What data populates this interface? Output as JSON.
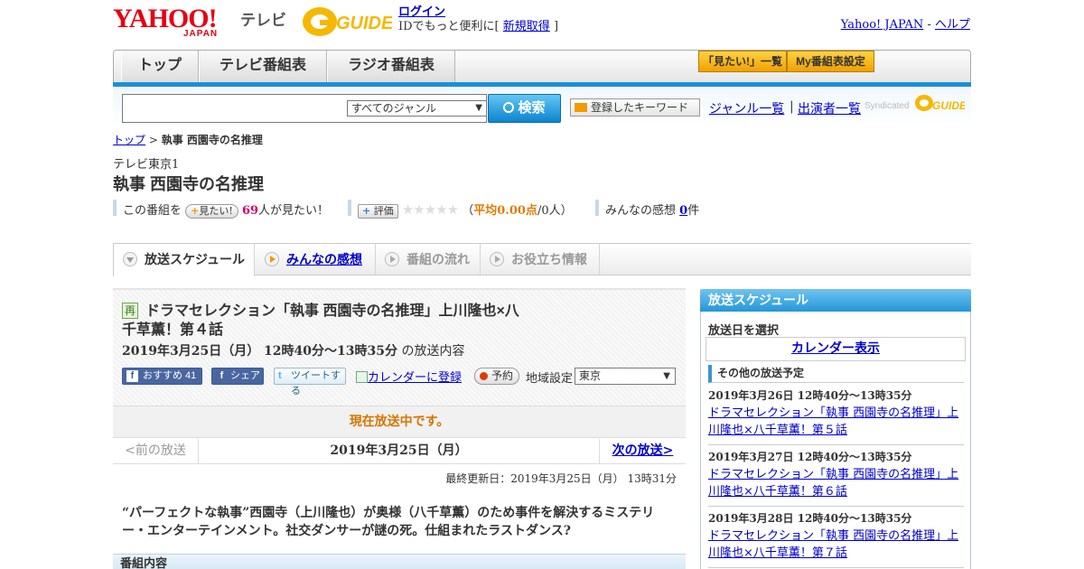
{
  "header": {
    "yahoo_logo": "YAHOO!",
    "yahoo_logo_sub": "JAPAN",
    "tv_label": "テレビ",
    "gguide_logo": "GUIDE",
    "login_label": "ログイン",
    "login_prompt": "IDでもっと便利に[",
    "signup_label": "新規取得",
    "signup_close": "]",
    "yahoo_japan_link": "Yahoo! JAPAN",
    "link_sep": " - ",
    "help_link": "ヘルプ"
  },
  "nav": {
    "tabs": [
      {
        "label": "トップ"
      },
      {
        "label": "テレビ番組表"
      },
      {
        "label": "ラジオ番組表"
      }
    ],
    "want_list": "「見たい!」一覧",
    "my_settings": "My番組表設定"
  },
  "search": {
    "input_value": "",
    "genre_selected": "すべてのジャンル",
    "search_button": "検索",
    "keyword_button": "登録したキーワード",
    "genre_list_link": "ジャンル一覧",
    "separator": "|",
    "cast_list_link": "出演者一覧",
    "syndicated": "Syndicated"
  },
  "breadcrumb": {
    "top": "トップ",
    "sep": " > ",
    "current": "執事 西園寺の名推理"
  },
  "program": {
    "channel": "テレビ東京1",
    "title": "執事 西園寺の名推理",
    "want_prefix": "この番組を",
    "want_button": "見たい!",
    "want_count": "69",
    "want_suffix": "人が見たい！",
    "rate_button": "評価",
    "stars": "★★★★★",
    "rating_open": "（",
    "rating_avg_label": "平均0.00点",
    "rating_count": "/0人）",
    "reviews_label": "みんなの感想",
    "reviews_count": "0",
    "reviews_unit": "件"
  },
  "content_tabs": {
    "schedule": "放送スケジュール",
    "reviews": "みんなの感想",
    "flow": "番組の流れ",
    "info": "お役立ち情報"
  },
  "episode": {
    "rerun_badge": "再",
    "title_line1": "ドラマセレクション「執事 西園寺の名推理」上川隆也×八",
    "title_line2": "千草薫！第４話",
    "datetime": "2019年3月25日（月） 12時40分～13時35分",
    "datetime_suffix": " の放送内容",
    "fb_recommend": "おすすめ 41",
    "fb_share": "シェア",
    "tweet": "ツイートする",
    "calendar_register": "カレンダーに登録",
    "reserve": "予約",
    "region_label": "地域設定",
    "region_selected": "東京",
    "on_air": "現在放送中です。",
    "prev": "<前の放送",
    "current_date": "2019年3月25日（月）",
    "next": "次の放送>",
    "updated": "最終更新日：2019年3月25日（月） 13時31分",
    "description": "“パーフェクトな執事”西園寺（上川隆也）が奥様（八千草薫）のため事件を解決するミステリー・エンターテインメント。社交ダンサーが謎の死。仕組まれたラストダンス?",
    "content_heading": "番組内容"
  },
  "sidebar": {
    "heading": "放送スケジュール",
    "date_select": "放送日を選択",
    "calendar_display": "カレンダー表示",
    "other_heading": "その他の放送予定",
    "items": [
      {
        "date": "2019年3月26日 12時40分～13時35分",
        "title": "ドラマセレクション「執事 西園寺の名推理」上川隆也×八千草薫！第５話"
      },
      {
        "date": "2019年3月27日 12時40分～13時35分",
        "title": "ドラマセレクション「執事 西園寺の名推理」上川隆也×八千草薫！第６話"
      },
      {
        "date": "2019年3月28日 12時40分～13時35分",
        "title": "ドラマセレクション「執事 西園寺の名推理」上川隆也×八千草薫！第７話"
      }
    ]
  },
  "colors": {
    "accent_blue": "#1b8fd6",
    "link": "#0000cc",
    "on_air_orange": "#d57500",
    "yahoo_red": "#e60012"
  }
}
